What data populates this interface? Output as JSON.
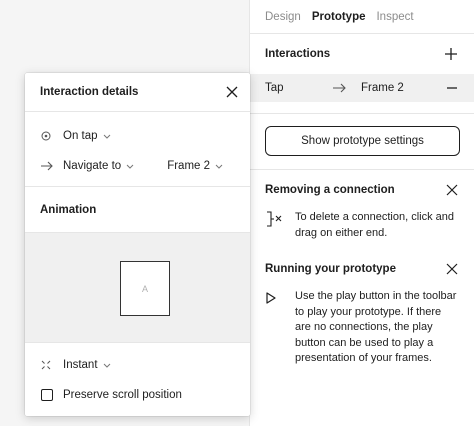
{
  "tabs": [
    {
      "label": "Design",
      "active": false
    },
    {
      "label": "Prototype",
      "active": true
    },
    {
      "label": "Inspect",
      "active": false
    }
  ],
  "interactions": {
    "title": "Interactions",
    "row": {
      "trigger": "Tap",
      "destination": "Frame 2"
    }
  },
  "prototype_button": "Show prototype settings",
  "help": {
    "removing": {
      "title": "Removing a connection",
      "text": "To delete a connection, click and drag on either end."
    },
    "running": {
      "title": "Running your prototype",
      "text": "Use the play button in the toolbar to play your prototype. If there are no connections, the play button can be used to play a presentation of your frames."
    }
  },
  "modal": {
    "title": "Interaction details",
    "trigger": "On tap",
    "action": "Navigate to",
    "destination": "Frame 2",
    "animation_title": "Animation",
    "preview_letter": "A",
    "transition": "Instant",
    "preserve_scroll": "Preserve scroll position"
  },
  "colors": {
    "text": "#1e1e1e",
    "muted": "#8c8c8c",
    "selected_row": "#f0f0f0",
    "border": "#e6e6e6"
  }
}
